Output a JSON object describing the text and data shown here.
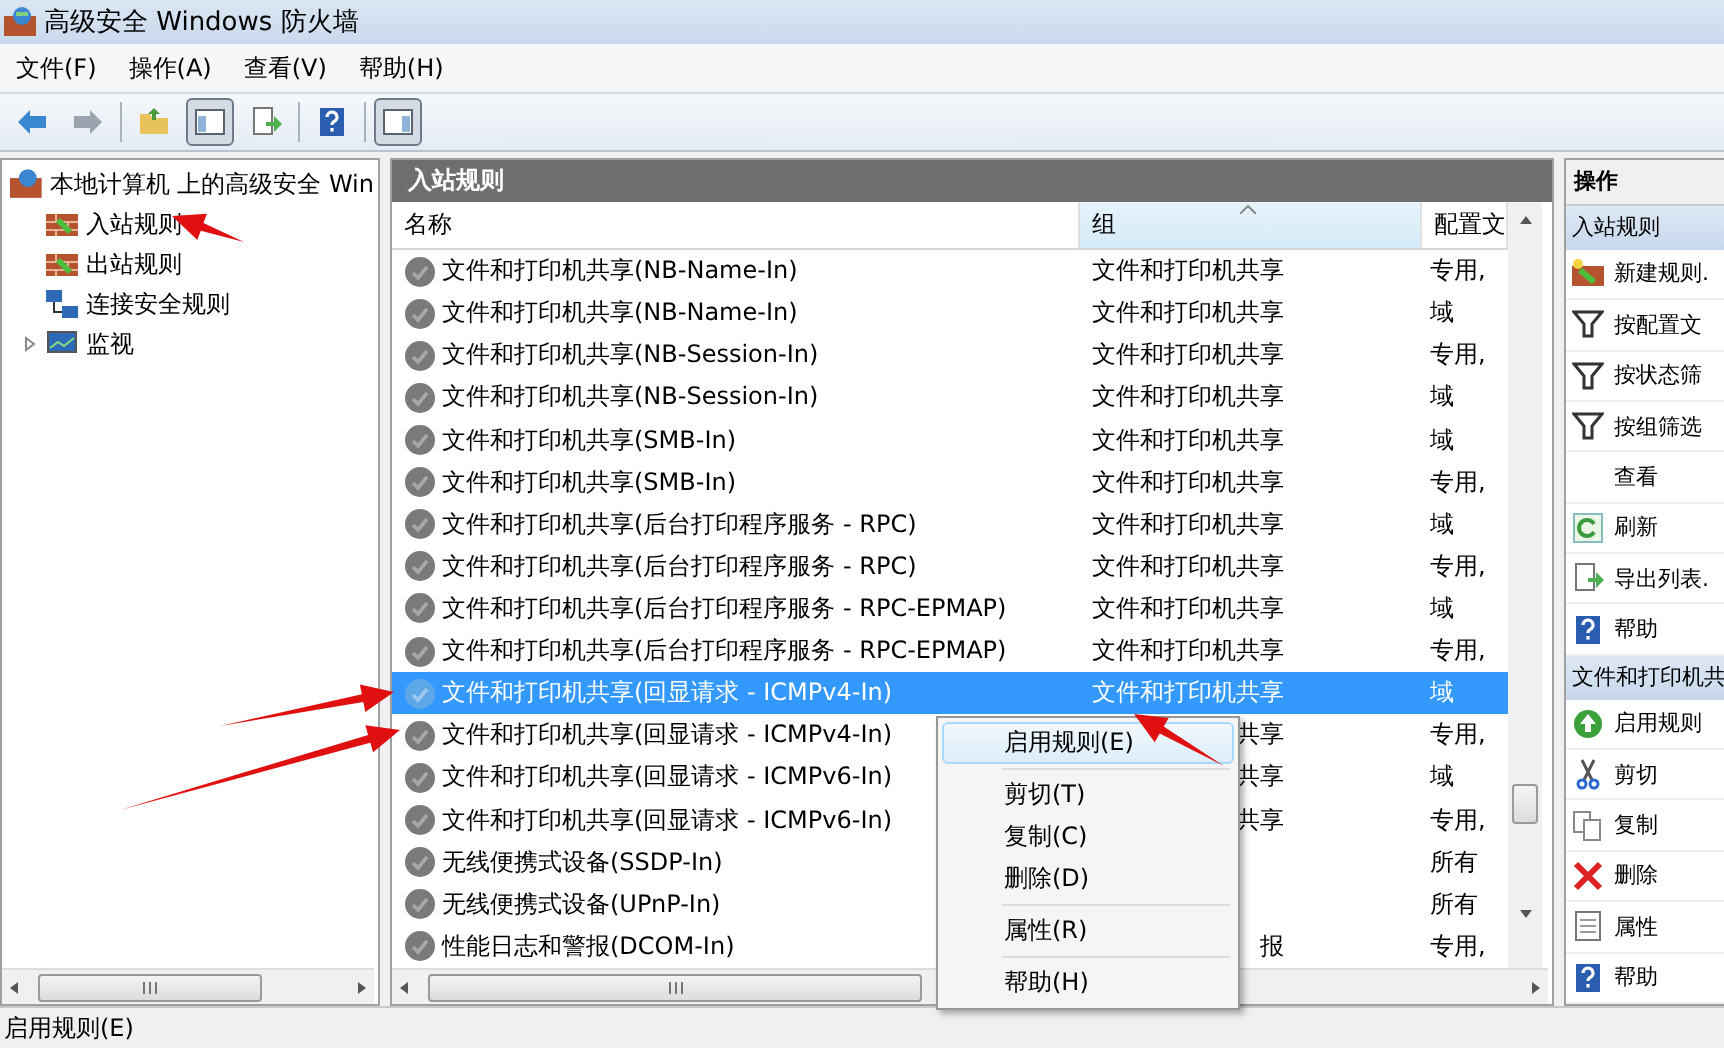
{
  "window": {
    "title": "高级安全 Windows 防火墙"
  },
  "menu": [
    "文件(F)",
    "操作(A)",
    "查看(V)",
    "帮助(H)"
  ],
  "toolbar": [
    {
      "kind": "back",
      "pressed": false
    },
    {
      "kind": "forward",
      "pressed": false
    },
    {
      "kind": "up",
      "pressed": false
    },
    {
      "kind": "tree",
      "pressed": true
    },
    {
      "kind": "export",
      "pressed": false
    },
    {
      "kind": "help",
      "pressed": false
    },
    {
      "kind": "actions",
      "pressed": true
    }
  ],
  "tree": {
    "label": "本地计算机 上的高级安全 Win",
    "children": [
      {
        "label": "入站规则",
        "kind": "inbound"
      },
      {
        "label": "出站规则",
        "kind": "outbound"
      },
      {
        "label": "连接安全规则",
        "kind": "connection"
      },
      {
        "label": "监视",
        "kind": "monitor",
        "expanded": false
      }
    ]
  },
  "rules": {
    "title": "入站规则",
    "columns": [
      {
        "label": "名称",
        "sorted": false
      },
      {
        "label": "组",
        "sorted": true
      },
      {
        "label": "配置文",
        "sorted": false
      }
    ],
    "rows": [
      {
        "name": "文件和打印机共享(NB-Name-In)",
        "group": "文件和打印机共享",
        "profile": "专用,",
        "enabled": false,
        "selected": false
      },
      {
        "name": "文件和打印机共享(NB-Name-In)",
        "group": "文件和打印机共享",
        "profile": "域",
        "enabled": false,
        "selected": false
      },
      {
        "name": "文件和打印机共享(NB-Session-In)",
        "group": "文件和打印机共享",
        "profile": "专用,",
        "enabled": false,
        "selected": false
      },
      {
        "name": "文件和打印机共享(NB-Session-In)",
        "group": "文件和打印机共享",
        "profile": "域",
        "enabled": false,
        "selected": false
      },
      {
        "name": "文件和打印机共享(SMB-In)",
        "group": "文件和打印机共享",
        "profile": "域",
        "enabled": false,
        "selected": false
      },
      {
        "name": "文件和打印机共享(SMB-In)",
        "group": "文件和打印机共享",
        "profile": "专用,",
        "enabled": false,
        "selected": false
      },
      {
        "name": "文件和打印机共享(后台打印程序服务 - RPC)",
        "group": "文件和打印机共享",
        "profile": "域",
        "enabled": false,
        "selected": false
      },
      {
        "name": "文件和打印机共享(后台打印程序服务 - RPC)",
        "group": "文件和打印机共享",
        "profile": "专用,",
        "enabled": false,
        "selected": false
      },
      {
        "name": "文件和打印机共享(后台打印程序服务 - RPC-EPMAP)",
        "group": "文件和打印机共享",
        "profile": "域",
        "enabled": false,
        "selected": false
      },
      {
        "name": "文件和打印机共享(后台打印程序服务 - RPC-EPMAP)",
        "group": "文件和打印机共享",
        "profile": "专用,",
        "enabled": false,
        "selected": false
      },
      {
        "name": "文件和打印机共享(回显请求 - ICMPv4-In)",
        "group": "文件和打印机共享",
        "profile": "域",
        "enabled": false,
        "selected": true
      },
      {
        "name": "文件和打印机共享(回显请求 - ICMPv4-In)",
        "group": "共享",
        "profile": "专用,",
        "enabled": false,
        "selected": false
      },
      {
        "name": "文件和打印机共享(回显请求 - ICMPv6-In)",
        "group": "共享",
        "profile": "域",
        "enabled": false,
        "selected": false
      },
      {
        "name": "文件和打印机共享(回显请求 - ICMPv6-In)",
        "group": "共享",
        "profile": "专用,",
        "enabled": false,
        "selected": false
      },
      {
        "name": "无线便携式设备(SSDP-In)",
        "profile": "所有",
        "enabled": false,
        "selected": false
      },
      {
        "name": "无线便携式设备(UPnP-In)",
        "profile": "所有",
        "enabled": false,
        "selected": false
      },
      {
        "name": "性能日志和警报(DCOM-In)",
        "group": "报",
        "profile": "专用,",
        "enabled": false,
        "selected": false
      }
    ]
  },
  "context_menu": {
    "items": [
      {
        "kind": "item",
        "label": "启用规则(E)",
        "highlighted": true
      },
      {
        "kind": "separator"
      },
      {
        "kind": "item",
        "label": "剪切(T)",
        "highlighted": false
      },
      {
        "kind": "item",
        "label": "复制(C)",
        "highlighted": false
      },
      {
        "kind": "item",
        "label": "删除(D)",
        "highlighted": false
      },
      {
        "kind": "separator"
      },
      {
        "kind": "item",
        "label": "属性(R)",
        "highlighted": false
      },
      {
        "kind": "separator"
      },
      {
        "kind": "item",
        "label": "帮助(H)",
        "highlighted": false
      }
    ]
  },
  "actions": {
    "title": "操作",
    "sections": [
      {
        "title": "入站规则",
        "items": [
          {
            "label": "新建规则.",
            "kind": "new"
          },
          {
            "label": "按配置文",
            "kind": "filter"
          },
          {
            "label": "按状态筛",
            "kind": "filter"
          },
          {
            "label": "按组筛选",
            "kind": "filter"
          },
          {
            "label": "查看",
            "kind": "none"
          },
          {
            "label": "刷新",
            "kind": "refresh"
          },
          {
            "label": "导出列表.",
            "kind": "export"
          },
          {
            "label": "帮助",
            "kind": "help"
          }
        ]
      },
      {
        "title": "文件和打印机共",
        "items": [
          {
            "label": "启用规则",
            "kind": "enable"
          },
          {
            "label": "剪切",
            "kind": "cut"
          },
          {
            "label": "复制",
            "kind": "copy"
          },
          {
            "label": "删除",
            "kind": "delete"
          },
          {
            "label": "属性",
            "kind": "properties"
          },
          {
            "label": "帮助",
            "kind": "help"
          }
        ]
      }
    ]
  },
  "status_bar": "启用规则(E)",
  "annotations": [
    {
      "kind": "arrow"
    },
    {
      "kind": "arrow"
    },
    {
      "kind": "arrow"
    },
    {
      "kind": "arrow"
    }
  ]
}
